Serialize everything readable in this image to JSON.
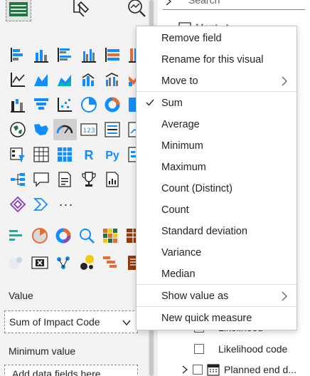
{
  "fields_pane": {
    "search_placeholder": "Search",
    "table_partial": "Mont...t",
    "rows": [
      {
        "label": "Likelihood"
      },
      {
        "label": "Likelihood code"
      },
      {
        "label": "Planned end d..."
      }
    ]
  },
  "viz_pane": {
    "value_label": "Value",
    "value_field": "Sum of Impact Code",
    "minimum_label": "Minimum value",
    "add_fields_placeholder": "Add data fields here"
  },
  "context_menu": {
    "items": [
      {
        "label": "Remove field"
      },
      {
        "label": "Rename for this visual"
      },
      {
        "label": "Move to"
      },
      {
        "label": "Sum"
      },
      {
        "label": "Average"
      },
      {
        "label": "Minimum"
      },
      {
        "label": "Maximum"
      },
      {
        "label": "Count (Distinct)"
      },
      {
        "label": "Count"
      },
      {
        "label": "Standard deviation"
      },
      {
        "label": "Variance"
      },
      {
        "label": "Median"
      },
      {
        "label": "Show value as"
      },
      {
        "label": "New quick measure"
      }
    ],
    "checked_item": "Sum"
  },
  "colors": {
    "accent_blue": "#118dff",
    "teal": "#01b8aa",
    "orange": "#e66c37",
    "purple": "#8f4bb5",
    "green": "#217346"
  }
}
